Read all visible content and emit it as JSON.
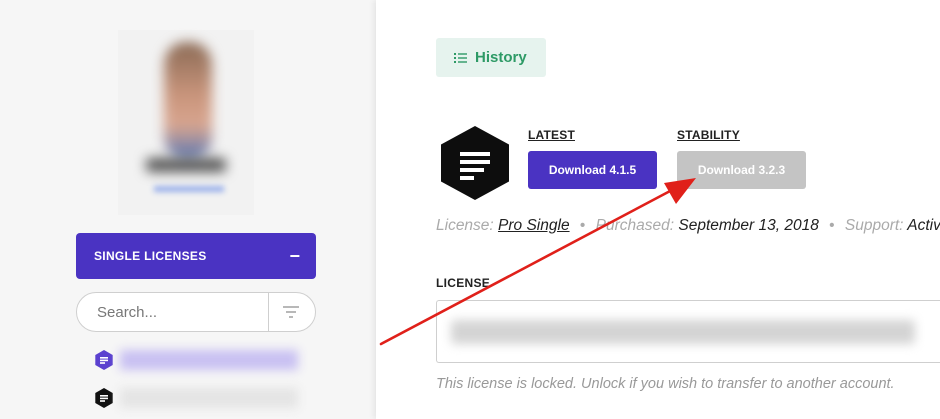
{
  "sidebar": {
    "section_label": "SINGLE LICENSES",
    "collapse_symbol": "−",
    "search": {
      "placeholder": "Search...",
      "value": ""
    },
    "products": [
      {
        "icon": "elementor-purple-icon",
        "color": "#5b41cf"
      },
      {
        "icon": "product-black-icon",
        "color": "#111111"
      }
    ]
  },
  "main": {
    "history_label": "History",
    "latest": {
      "label": "LATEST",
      "button": "Download 4.1.5",
      "color": "#4a33c2"
    },
    "stability": {
      "label": "STABILITY",
      "button": "Download 3.2.3",
      "color": "#c4c4c4"
    },
    "meta": {
      "license_label": "License:",
      "license_value": "Pro Single",
      "purchased_label": "Purchased:",
      "purchased_value": "September 13, 2018",
      "support_label": "Support:",
      "support_value": "Active",
      "separator": "•"
    },
    "license_field_label": "LICENSE",
    "license_note": "This license is locked. Unlock if you wish to transfer to another account."
  },
  "annotation": {
    "color": "#e0201a"
  }
}
